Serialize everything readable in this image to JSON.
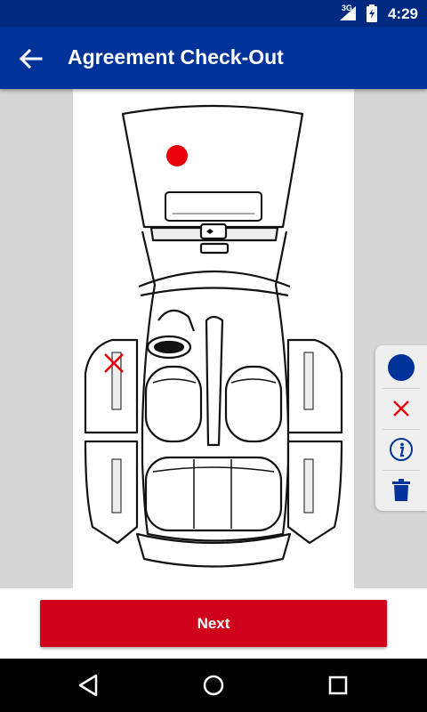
{
  "status_bar": {
    "time": "4:29",
    "network": "3G"
  },
  "app_bar": {
    "title": "Agreement Check-Out",
    "back_icon": "arrow-back-icon"
  },
  "diagram": {
    "name": "vehicle-top-view-diagram",
    "markers": [
      {
        "type": "dot",
        "color": "#e8000b"
      },
      {
        "type": "cross",
        "color": "#e8000b"
      }
    ]
  },
  "tools": [
    {
      "name": "damage-dot-tool",
      "icon": "filled-circle-icon",
      "color": "#003399"
    },
    {
      "name": "damage-cross-tool",
      "icon": "cross-icon",
      "color": "#e8000b"
    },
    {
      "name": "info-tool",
      "icon": "info-icon",
      "color": "#003399"
    },
    {
      "name": "delete-tool",
      "icon": "trash-icon",
      "color": "#003399"
    }
  ],
  "footer": {
    "next_label": "Next"
  },
  "colors": {
    "primary": "#003399",
    "status": "#002a80",
    "accent": "#d0021b"
  }
}
